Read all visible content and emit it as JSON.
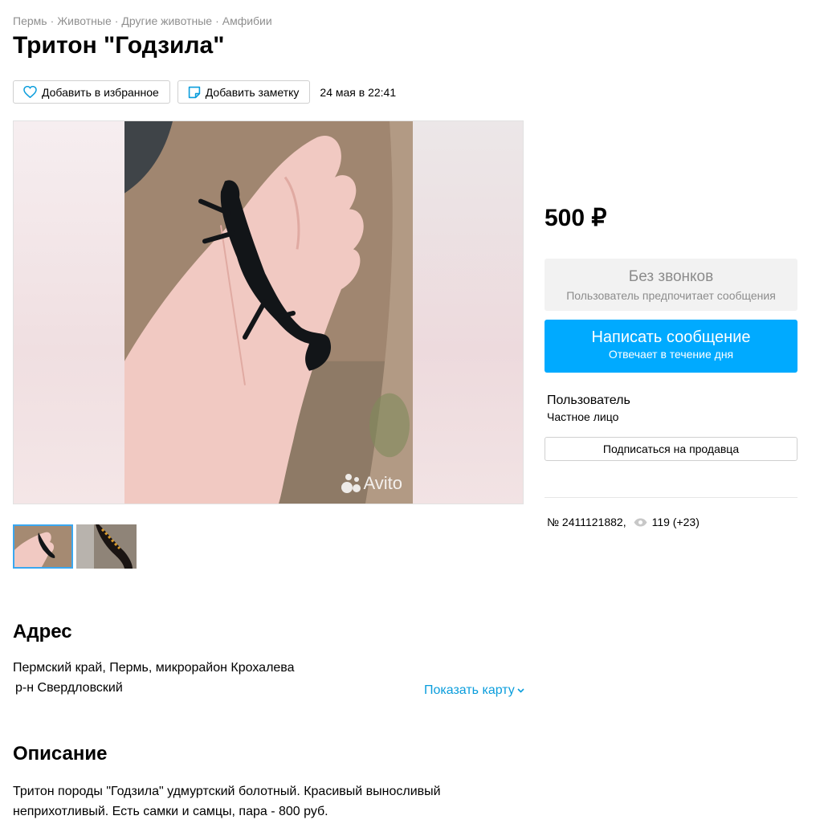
{
  "breadcrumbs": [
    "Пермь",
    "Животные",
    "Другие животные",
    "Амфибии"
  ],
  "title": "Тритон \"Годзила\"",
  "actions": {
    "favorite_label": "Добавить в избранное",
    "note_label": "Добавить заметку",
    "date": "24 мая в 22:41"
  },
  "gallery": {
    "watermark": "Avito",
    "thumbnail_count": 2,
    "active_thumbnail": 1
  },
  "price": "500 ₽",
  "no_calls": {
    "title": "Без звонков",
    "subtitle": "Пользователь предпочитает сообщения"
  },
  "message_button": {
    "title": "Написать сообщение",
    "subtitle": "Отвечает в течение дня"
  },
  "seller": {
    "name": "Пользователь",
    "type": "Частное лицо",
    "subscribe_label": "Подписаться на продавца"
  },
  "meta": {
    "item_number": "№ 2411121882,",
    "views": "119 (+23)"
  },
  "address": {
    "heading": "Адрес",
    "line1": "Пермский край, Пермь, микрорайон Крохалева",
    "line2": "р-н Свердловский",
    "map_link": "Показать карту"
  },
  "description": {
    "heading": "Описание",
    "text": "Тритон породы \"Годзила\" удмуртский болотный. Красивый выносливый неприхотливый. Есть самки и самцы, пара - 800 руб."
  },
  "colors": {
    "accent": "#00aaff",
    "link": "#0a9ddc",
    "muted": "#8f8f8f"
  }
}
